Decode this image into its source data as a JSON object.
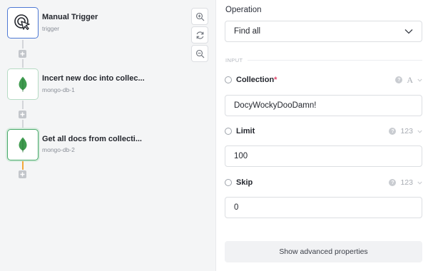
{
  "canvas": {
    "nodes": [
      {
        "title": "Manual Trigger",
        "subtitle": "trigger",
        "icon": "cursor-click-icon"
      },
      {
        "title": "Incert new doc into collec...",
        "subtitle": "mongo-db-1",
        "icon": "mongodb-leaf-icon"
      },
      {
        "title": "Get all docs from collecti...",
        "subtitle": "mongo-db-2",
        "icon": "mongodb-leaf-icon"
      }
    ],
    "tools": [
      "zoom-in-icon",
      "refresh-icon",
      "zoom-out-icon"
    ],
    "colors": {
      "trigger_border": "#4e79d4",
      "mongo_green": "#48a96a",
      "active_connector": "#f2a83a"
    }
  },
  "panel": {
    "operation_label": "Operation",
    "operation_value": "Find all",
    "section_input": "INPUT",
    "properties": [
      {
        "name": "Collection",
        "required": "*",
        "type": "A",
        "value": "DocyWockyDooDamn!"
      },
      {
        "name": "Limit",
        "required": "",
        "type": "123",
        "value": "100"
      },
      {
        "name": "Skip",
        "required": "",
        "type": "123",
        "value": "0"
      }
    ],
    "help_glyph": "?",
    "advanced_button": "Show advanced properties"
  }
}
